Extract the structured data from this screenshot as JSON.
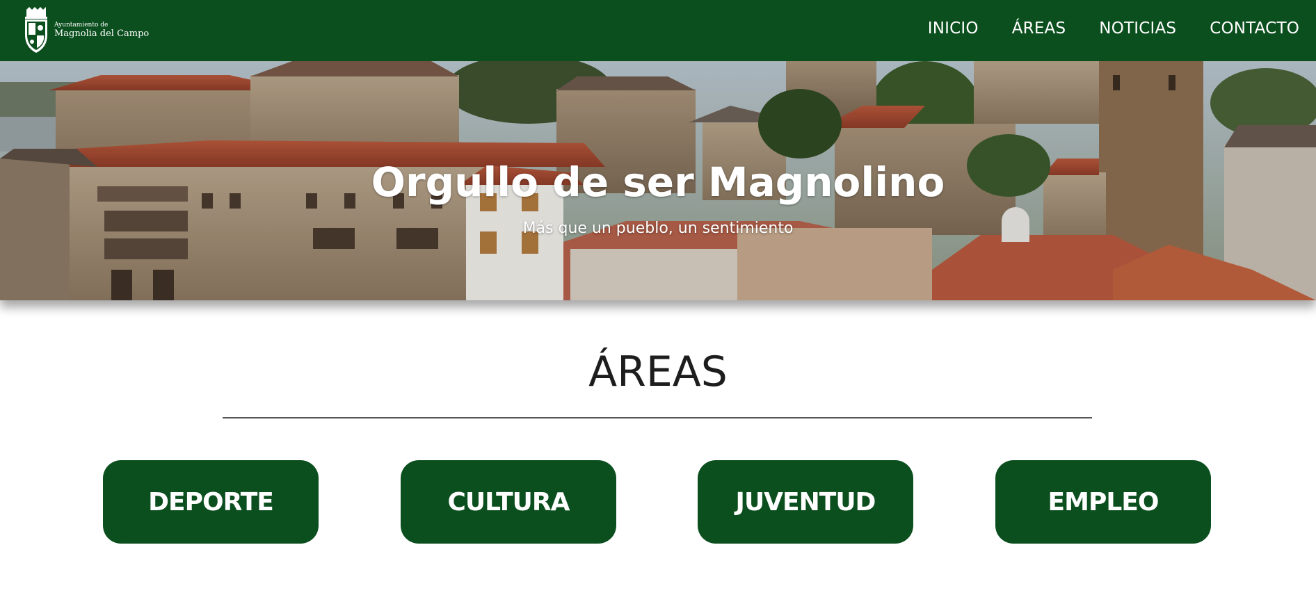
{
  "header": {
    "logo_small": "Ayuntamiento de",
    "logo_big": "Magnolia del Campo",
    "nav": [
      {
        "label": "INICIO"
      },
      {
        "label": "ÁREAS"
      },
      {
        "label": "NOTICIAS"
      },
      {
        "label": "CONTACTO"
      }
    ]
  },
  "hero": {
    "title": "Orgullo de ser Magnolino",
    "subtitle": "Más que un pueblo, un sentimiento"
  },
  "areas": {
    "title": "ÁREAS",
    "buttons": [
      {
        "label": "DEPORTE"
      },
      {
        "label": "CULTURA"
      },
      {
        "label": "JUVENTUD"
      },
      {
        "label": "EMPLEO"
      }
    ]
  },
  "colors": {
    "brand_green": "#0c4f1f",
    "text_white": "#ffffff"
  },
  "icons": {
    "logo": "town-coat-of-arms-icon"
  }
}
